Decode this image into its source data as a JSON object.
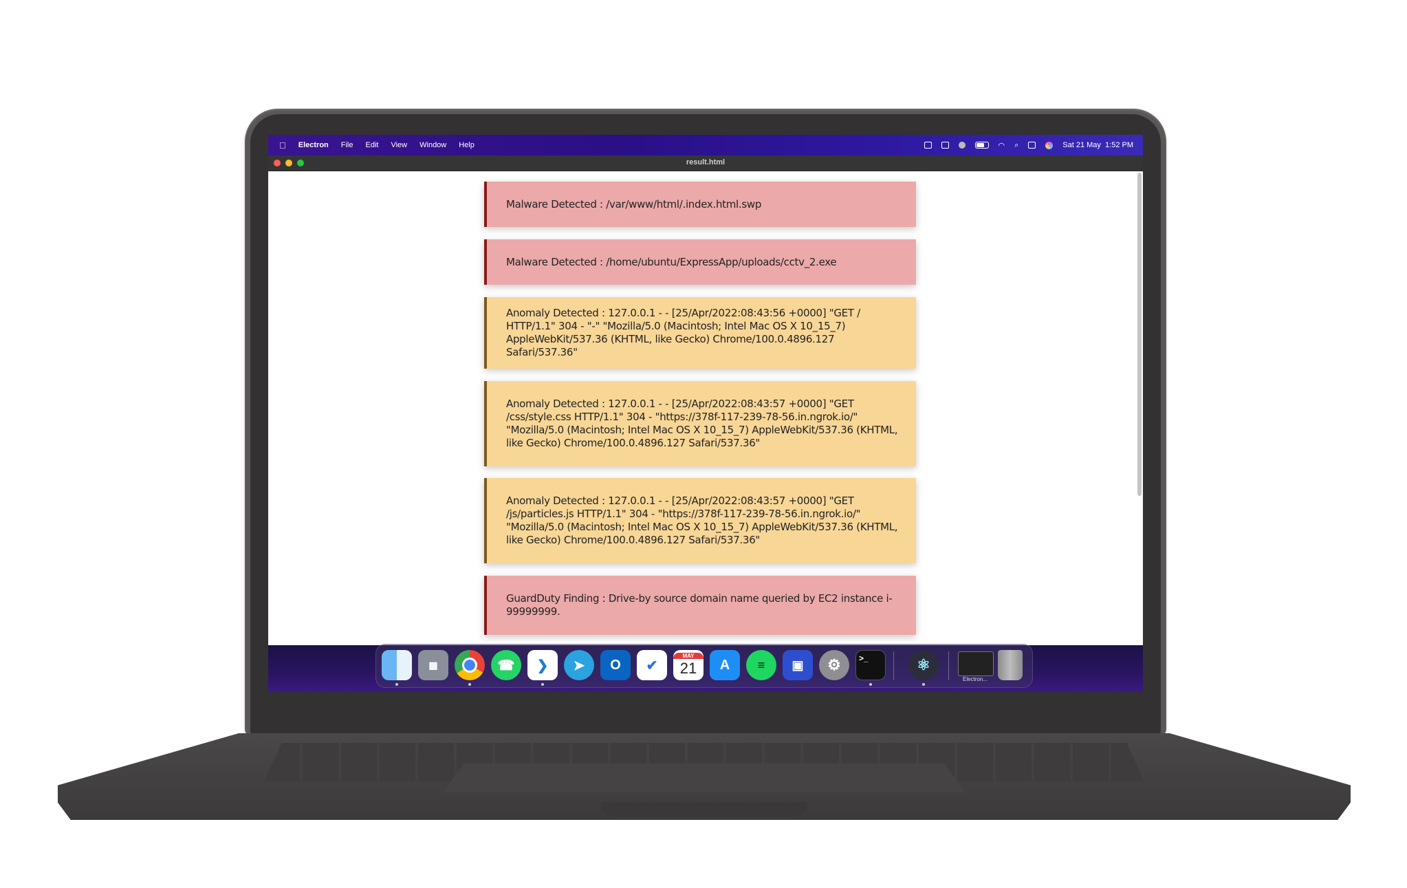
{
  "menubar": {
    "apple_icon": "apple-icon",
    "app_name": "Electron",
    "menus": [
      "File",
      "Edit",
      "View",
      "Window",
      "Help"
    ],
    "datetime": "Sat 21 May  1:52 PM"
  },
  "window": {
    "title": "result.html"
  },
  "alerts": [
    {
      "kind": "malware",
      "text": "Malware Detected : /var/www/html/.index.html.swp"
    },
    {
      "kind": "malware",
      "text": "Malware Detected : /home/ubuntu/ExpressApp/uploads/cctv_2.exe"
    },
    {
      "kind": "anomaly",
      "text": "Anomaly Detected : 127.0.0.1 - - [25/Apr/2022:08:43:56 +0000] \"GET / HTTP/1.1\" 304 - \"-\" \"Mozilla/5.0 (Macintosh; Intel Mac OS X 10_15_7) AppleWebKit/537.36 (KHTML, like Gecko) Chrome/100.0.4896.127 Safari/537.36\""
    },
    {
      "kind": "anomaly",
      "text": "Anomaly Detected : 127.0.0.1 - - [25/Apr/2022:08:43:57 +0000] \"GET /css/style.css HTTP/1.1\" 304 - \"https://378f-117-239-78-56.in.ngrok.io/\" \"Mozilla/5.0 (Macintosh; Intel Mac OS X 10_15_7) AppleWebKit/537.36 (KHTML, like Gecko) Chrome/100.0.4896.127 Safari/537.36\""
    },
    {
      "kind": "anomaly",
      "text": "Anomaly Detected : 127.0.0.1 - - [25/Apr/2022:08:43:57 +0000] \"GET /js/particles.js HTTP/1.1\" 304 - \"https://378f-117-239-78-56.in.ngrok.io/\" \"Mozilla/5.0 (Macintosh; Intel Mac OS X 10_15_7) AppleWebKit/537.36 (KHTML, like Gecko) Chrome/100.0.4896.127 Safari/537.36\""
    },
    {
      "kind": "malware",
      "text": "GuardDuty Finding : Drive-by source domain name queried by EC2 instance i-99999999."
    }
  ],
  "colors": {
    "malware_bg": "#eca9a9",
    "malware_border": "#8a1a1a",
    "anomaly_bg": "#f8d696",
    "anomaly_border": "#7a5a20",
    "menubar": "#2a0f86"
  },
  "dock": {
    "apps": [
      "finder-icon",
      "launchpad-icon",
      "chrome-icon",
      "whatsapp-icon",
      "vscode-icon",
      "telegram-icon",
      "outlook-icon",
      "tasks-icon",
      "calendar-icon",
      "app-store-icon",
      "spotify-icon",
      "screen-app-icon",
      "system-preferences-icon",
      "terminal-icon",
      "electron-icon"
    ],
    "calendar_month": "MAY",
    "calendar_day": "21",
    "minimized_label": "Electron..."
  }
}
